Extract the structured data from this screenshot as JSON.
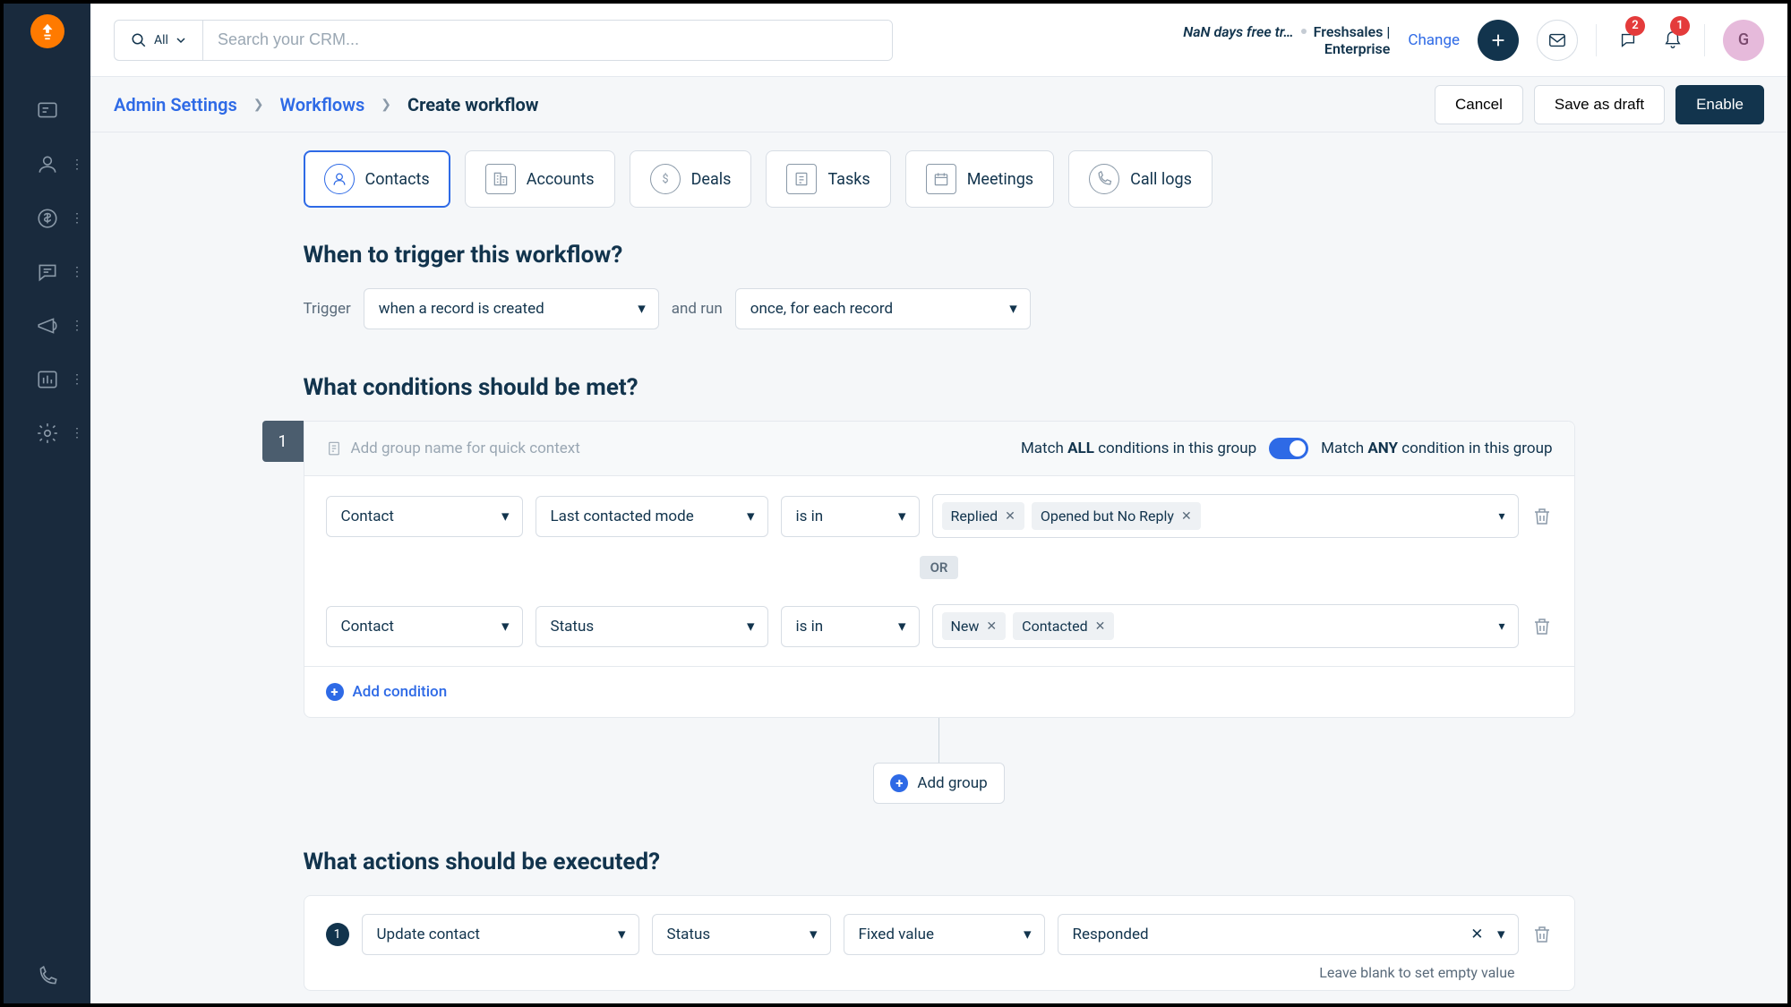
{
  "header": {
    "search_filter": "All",
    "search_placeholder": "Search your CRM...",
    "trial_text": "NaN days free tr…",
    "product": "Freshsales |",
    "plan": "Enterprise",
    "change": "Change",
    "chat_badge": "2",
    "bell_badge": "1",
    "avatar_initial": "G"
  },
  "crumbs": {
    "admin": "Admin Settings",
    "workflows": "Workflows",
    "current": "Create workflow",
    "cancel": "Cancel",
    "save_draft": "Save as draft",
    "enable": "Enable"
  },
  "tabs": {
    "contacts": "Contacts",
    "accounts": "Accounts",
    "deals": "Deals",
    "tasks": "Tasks",
    "meetings": "Meetings",
    "call_logs": "Call logs"
  },
  "trigger": {
    "title": "When to trigger this workflow?",
    "label": "Trigger",
    "when": "when a record is created",
    "and_run": "and run",
    "run": "once, for each record"
  },
  "conditions": {
    "title": "What conditions should be met?",
    "group_number": "1",
    "group_placeholder": "Add group name for quick context",
    "match_all_pre": "Match ",
    "match_all_bold": "ALL",
    "match_all_post": " conditions in this group",
    "match_any_pre": "Match ",
    "match_any_bold": "ANY",
    "match_any_post": " condition in this group",
    "or": "OR",
    "add_condition": "Add condition",
    "add_group": "Add group",
    "rows": [
      {
        "entity": "Contact",
        "field": "Last contacted mode",
        "op": "is in",
        "tags": [
          "Replied",
          "Opened but No Reply"
        ]
      },
      {
        "entity": "Contact",
        "field": "Status",
        "op": "is in",
        "tags": [
          "New",
          "Contacted"
        ]
      }
    ]
  },
  "actions": {
    "title": "What actions should be executed?",
    "number": "1",
    "action": "Update contact",
    "field": "Status",
    "type": "Fixed value",
    "value": "Responded",
    "helper": "Leave blank to set empty value"
  }
}
